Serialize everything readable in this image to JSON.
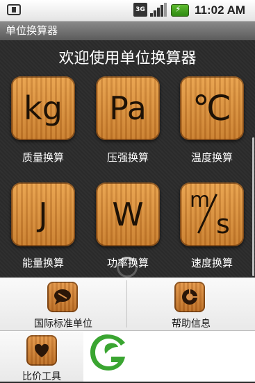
{
  "status_bar": {
    "network": "3G",
    "time": "11:02 AM",
    "icons": [
      "sim-icon",
      "signal-icon",
      "battery-icon"
    ]
  },
  "app": {
    "title": "单位换算器",
    "welcome": "欢迎使用单位换算器"
  },
  "tiles": [
    {
      "symbol": "kg",
      "label": "质量换算",
      "icon": "kg-icon"
    },
    {
      "symbol": "Pa",
      "label": "压强换算",
      "icon": "pa-icon"
    },
    {
      "symbol": "℃",
      "label": "温度换算",
      "icon": "celsius-icon"
    },
    {
      "symbol": "J",
      "label": "能量换算",
      "icon": "joule-icon"
    },
    {
      "symbol": "W",
      "label": "功率换算",
      "icon": "watt-icon"
    },
    {
      "symbol_m": "m",
      "symbol_s": "s",
      "label": "速度换算",
      "icon": "meters-per-second-icon"
    }
  ],
  "menu": {
    "items": [
      {
        "label": "国际标准单位",
        "icon": "chat-bubble-icon"
      },
      {
        "label": "帮助信息",
        "icon": "help-icon"
      },
      {
        "label": "比价工具",
        "icon": "heart-icon"
      }
    ]
  },
  "colors": {
    "tile_wood": "#d88c3a",
    "background": "#2b2b2b",
    "logo_green": "#3aa531"
  }
}
